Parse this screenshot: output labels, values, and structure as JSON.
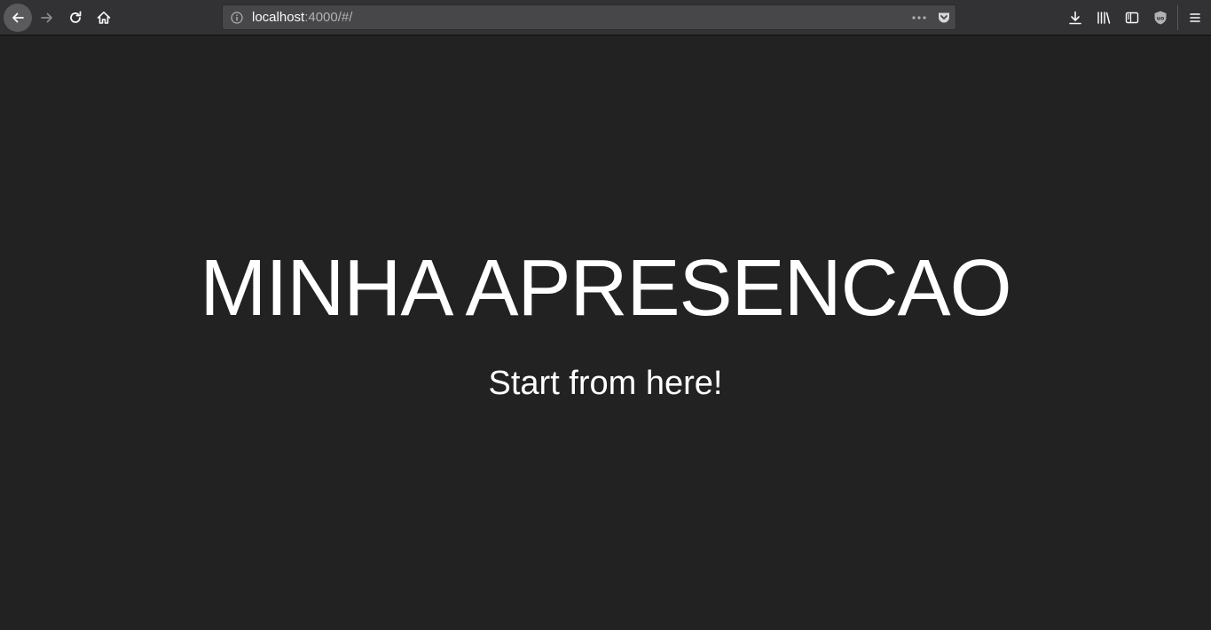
{
  "browser": {
    "url": {
      "host": "localhost",
      "rest": ":4000/#/"
    },
    "icons": {
      "back": "back-arrow-icon",
      "forward": "forward-arrow-icon",
      "reload": "reload-icon",
      "home": "home-icon",
      "info": "info-icon",
      "page_actions": "ellipsis-icon",
      "pocket": "pocket-icon",
      "downloads": "download-icon",
      "library": "library-icon",
      "sidebar": "sidebar-icon",
      "ublock": "ublock-icon",
      "menu": "hamburger-menu-icon"
    },
    "colors": {
      "toolbar": "#323234",
      "urlbar": "#474749",
      "page_background": "#222222",
      "text": "#ffffff"
    }
  },
  "slide": {
    "title": "MINHA APRESENCAO",
    "subtitle": "Start from here!"
  }
}
